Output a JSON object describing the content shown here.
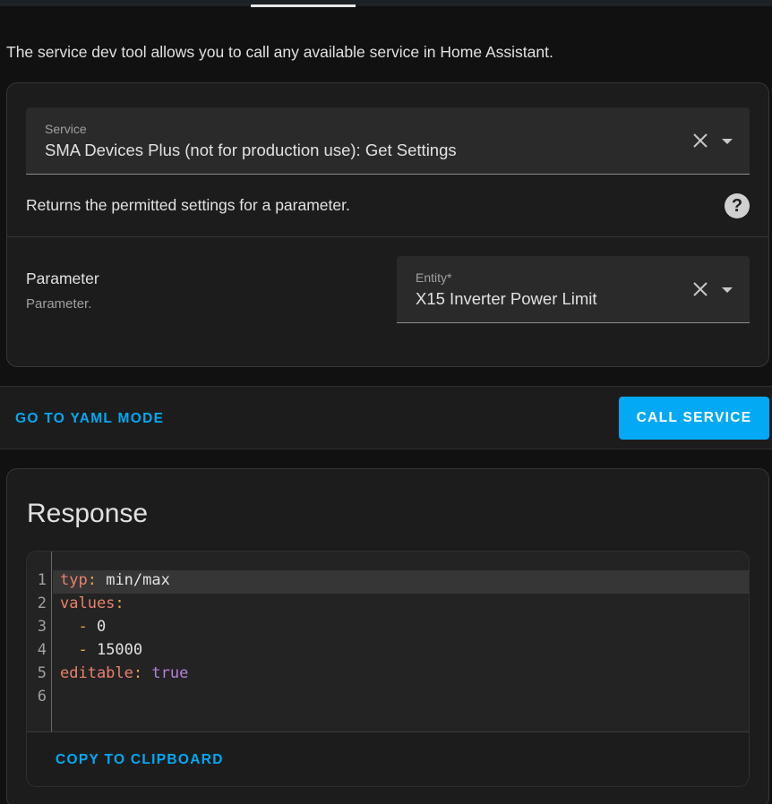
{
  "intro_text": "The service dev tool allows you to call any available service in Home Assistant.",
  "service_field": {
    "label": "Service",
    "value": "SMA Devices Plus (not for production use): Get Settings"
  },
  "service_description": "Returns the permitted settings for a parameter.",
  "help_icon_glyph": "?",
  "parameter": {
    "name": "Parameter",
    "description": "Parameter.",
    "entity_field": {
      "label": "Entity*",
      "value": "X15 Inverter Power Limit"
    }
  },
  "actions": {
    "yaml_mode": "GO TO YAML MODE",
    "call_service": "CALL SERVICE"
  },
  "response": {
    "title": "Response",
    "line_numbers": [
      "1",
      "2",
      "3",
      "4",
      "5",
      "6"
    ],
    "code": {
      "l1_key": "typ",
      "l1_colon": ":",
      "l1_value": " min/max",
      "l2_key": "values",
      "l2_colon": ":",
      "l3_dash": "  -",
      "l3_value": " 0",
      "l4_dash": "  -",
      "l4_value": " 15000",
      "l5_key": "editable",
      "l5_colon": ":",
      "l5_value": " true"
    },
    "copy_button": "COPY TO CLIPBOARD"
  },
  "colors": {
    "accent": "#03a9f4",
    "background": "#111111",
    "card": "#1c1c1c",
    "yaml_key": "#e8826b",
    "yaml_bool": "#b581d6",
    "yaml_dash": "#e8a64c"
  },
  "icons": {
    "clear": "close-icon",
    "dropdown": "menu-down-icon",
    "help": "help-circle-icon"
  }
}
